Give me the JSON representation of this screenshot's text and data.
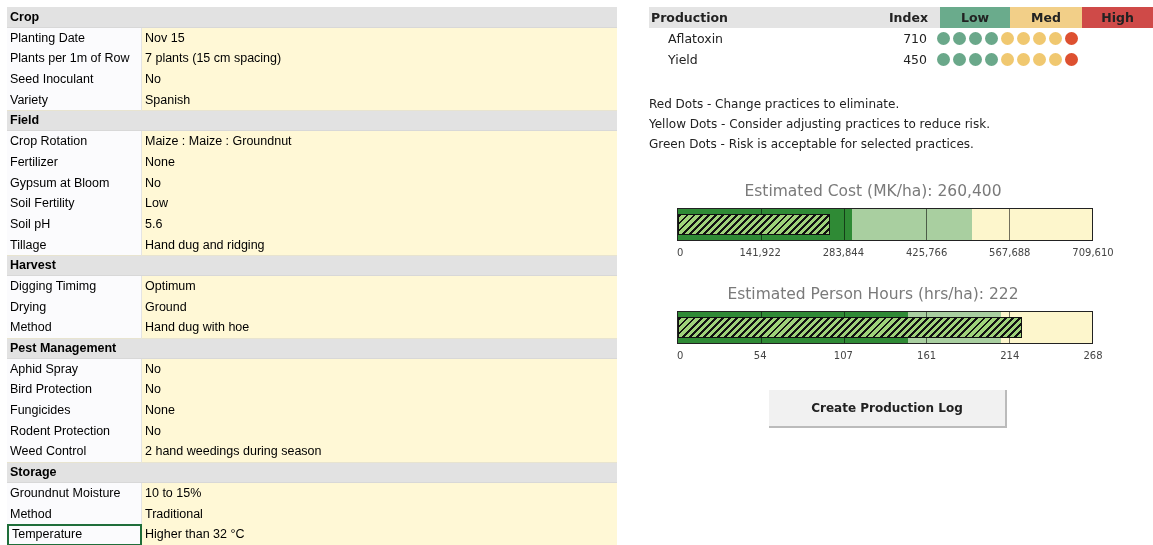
{
  "sheet": {
    "sections": [
      {
        "title": "Crop",
        "rows": [
          {
            "label": "Planting Date",
            "value": "Nov 15",
            "selected": false
          },
          {
            "label": "Plants per 1m of Row",
            "value": "7 plants (15 cm spacing)",
            "selected": false
          },
          {
            "label": "Seed Inoculant",
            "value": "No",
            "selected": false
          },
          {
            "label": "Variety",
            "value": "Spanish",
            "selected": false
          }
        ]
      },
      {
        "title": "Field",
        "rows": [
          {
            "label": "Crop Rotation",
            "value": "Maize : Maize : Groundnut",
            "selected": false
          },
          {
            "label": "Fertilizer",
            "value": "None",
            "selected": false
          },
          {
            "label": "Gypsum at Bloom",
            "value": "No",
            "selected": false
          },
          {
            "label": "Soil Fertility",
            "value": "Low",
            "selected": false
          },
          {
            "label": "Soil pH",
            "value": "5.6",
            "selected": false
          },
          {
            "label": "Tillage",
            "value": "Hand dug and ridging",
            "selected": false
          }
        ]
      },
      {
        "title": "Harvest",
        "rows": [
          {
            "label": "Digging Timimg",
            "value": "Optimum",
            "selected": false
          },
          {
            "label": "Drying",
            "value": "Ground",
            "selected": false
          },
          {
            "label": "Method",
            "value": "Hand dug with hoe",
            "selected": false
          }
        ]
      },
      {
        "title": "Pest Management",
        "rows": [
          {
            "label": "Aphid Spray",
            "value": "No",
            "selected": false
          },
          {
            "label": "Bird Protection",
            "value": "No",
            "selected": false
          },
          {
            "label": "Fungicides",
            "value": "None",
            "selected": false
          },
          {
            "label": "Rodent Protection",
            "value": "No",
            "selected": false
          },
          {
            "label": "Weed Control",
            "value": "2 hand weedings during season",
            "selected": false
          }
        ]
      },
      {
        "title": "Storage",
        "rows": [
          {
            "label": "Groundnut Moisture",
            "value": "10 to 15%",
            "selected": false
          },
          {
            "label": "Method",
            "value": "Traditional",
            "selected": false
          },
          {
            "label": "Temperature",
            "value": "Higher than 32 °C",
            "selected": true
          }
        ]
      }
    ]
  },
  "production": {
    "heading": "Production",
    "index_heading": "Index",
    "levels": [
      {
        "label": "Low",
        "color": "#6aab8c"
      },
      {
        "label": "Med",
        "color": "#f2cf88"
      },
      {
        "label": "High",
        "color": "#cf4a48"
      }
    ],
    "rows": [
      {
        "name": "Aflatoxin",
        "index": "710",
        "dots": [
          {
            "color": "#6aa88a"
          },
          {
            "color": "#6aa88a"
          },
          {
            "color": "#6aa88a"
          },
          {
            "color": "#6aa88a"
          },
          {
            "color": "#f0c870"
          },
          {
            "color": "#f0c870"
          },
          {
            "color": "#f0c870"
          },
          {
            "color": "#f0c870"
          },
          {
            "color": "#dd5030"
          }
        ]
      },
      {
        "name": "Yield",
        "index": "450",
        "dots": [
          {
            "color": "#6aa88a"
          },
          {
            "color": "#6aa88a"
          },
          {
            "color": "#6aa88a"
          },
          {
            "color": "#6aa88a"
          },
          {
            "color": "#f0c870"
          },
          {
            "color": "#f0c870"
          },
          {
            "color": "#f0c870"
          },
          {
            "color": "#f0c870"
          },
          {
            "color": "#dd5030"
          }
        ]
      }
    ]
  },
  "legend": [
    "Red Dots - Change practices to eliminate.",
    "Yellow Dots - Consider adjusting practices to reduce risk.",
    "Green Dots - Risk is acceptable for selected practices."
  ],
  "charts": [
    {
      "title": "Estimated Cost (MK/ha): 260,400",
      "measure": {
        "level": 0.367
      },
      "bands": [
        {
          "color": "#2f8a35",
          "level": 0.42
        },
        {
          "color": "#a9cfa0",
          "level": 0.71
        }
      ],
      "ticks": [
        "0",
        "141,922",
        "283,844",
        "425,766",
        "567,688",
        "709,610"
      ]
    },
    {
      "title": "Estimated Person Hours (hrs/ha): 222",
      "measure": {
        "level": 0.83
      },
      "bands": [
        {
          "color": "#2f8a35",
          "level": 0.555
        },
        {
          "color": "#a9cfa0",
          "level": 0.78
        }
      ],
      "ticks": [
        "0",
        "54",
        "107",
        "161",
        "214",
        "268"
      ]
    }
  ],
  "button": {
    "label": "Create Production Log"
  }
}
